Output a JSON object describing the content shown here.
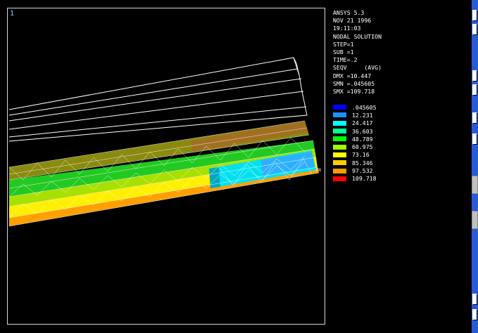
{
  "window_number": "1",
  "info": {
    "program": "ANSYS 5.3",
    "date": "NOV 21 1996",
    "time": "19:11:03",
    "solution": "NODAL SOLUTION",
    "step": "STEP=1",
    "sub": "SUB =1",
    "time_value": "TIME=.2",
    "item": "SEQV     (AVG)",
    "dmx": "DMX =10.447",
    "smn": "SMN =.045605",
    "smx": "SMX =109.718"
  },
  "legend": {
    "entries": [
      {
        "value": ".045605",
        "color": "#0000ff"
      },
      {
        "value": "12.231",
        "color": "#1f8fff"
      },
      {
        "value": "24.417",
        "color": "#00ffff"
      },
      {
        "value": "36.603",
        "color": "#00ff99"
      },
      {
        "value": "48.789",
        "color": "#00ff00"
      },
      {
        "value": "60.975",
        "color": "#99ff00"
      },
      {
        "value": "73.16",
        "color": "#ffff00"
      },
      {
        "value": "85.346",
        "color": "#ffcc00"
      },
      {
        "value": "97.532",
        "color": "#ff9900"
      },
      {
        "value": "109.718",
        "color": "#ff0000"
      }
    ]
  },
  "model_label": "MX"
}
